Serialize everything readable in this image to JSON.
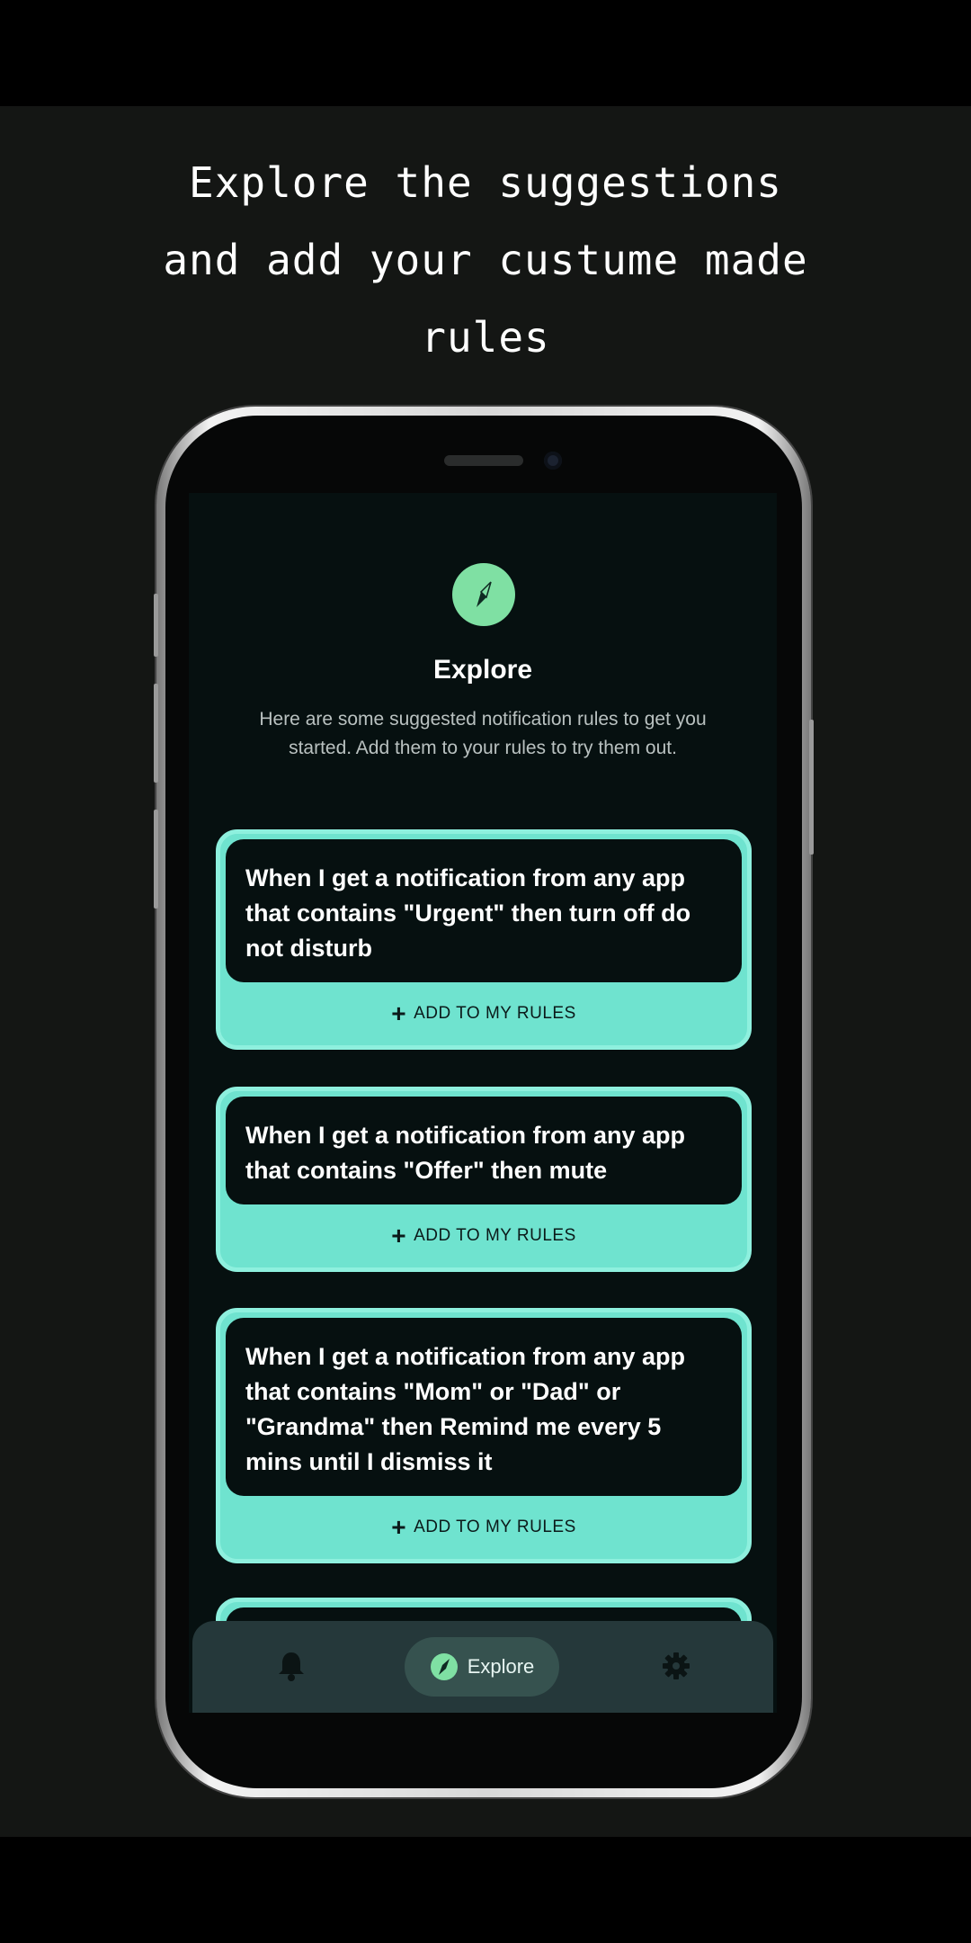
{
  "headline": {
    "line1": "Explore the suggestions",
    "line2": "and add your custume made",
    "line3": "rules"
  },
  "screen": {
    "icon": "compass-icon",
    "title": "Explore",
    "description": "Here are some suggested notification rules to get you started. Add them to your rules to try them out."
  },
  "rules": [
    {
      "text": "When I get a notification from any app that contains \"Urgent\" then turn off do not disturb",
      "action": "ADD TO MY RULES"
    },
    {
      "text": "When I get a notification from any app that contains \"Offer\" then mute",
      "action": "ADD TO MY RULES"
    },
    {
      "text": "When I get a notification from any app that contains \"Mom\" or \"Dad\" or \"Grandma\" then Remind me every 5 mins until I dismiss it",
      "action": "ADD TO MY RULES"
    }
  ],
  "bottom_nav": {
    "items": [
      {
        "icon": "bell-icon"
      },
      {
        "icon": "compass-icon",
        "label": "Explore",
        "active": true
      },
      {
        "icon": "gear-icon"
      }
    ]
  },
  "colors": {
    "accent": "#6fe3cf",
    "icon_green": "#7fe0a3",
    "screen_bg": "#061010",
    "nav_bg": "#25383a"
  }
}
